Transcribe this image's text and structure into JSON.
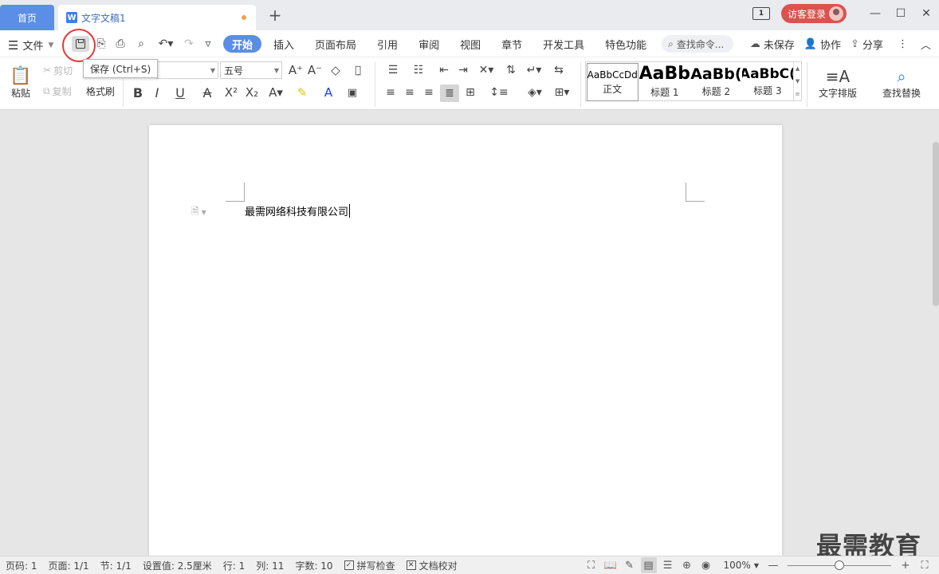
{
  "titlebar": {
    "home_tab": "首页",
    "doc_tab": "文字文稿1",
    "doc_icon": "W",
    "new_tab": "+",
    "screen_label": "1",
    "login": "访客登录",
    "minimize": "—",
    "maximize": "☐",
    "close": "✕"
  },
  "menubar": {
    "file": "文件",
    "tabs": [
      "开始",
      "插入",
      "页面布局",
      "引用",
      "审阅",
      "视图",
      "章节",
      "开发工具",
      "特色功能"
    ],
    "search_placeholder": "查找命令...",
    "unsaved": "未保存",
    "collab": "协作",
    "share": "分享"
  },
  "tooltip": "保存 (Ctrl+S)",
  "ribbon": {
    "paste": "粘贴",
    "cut": "剪切",
    "copy": "复制",
    "format_painter": "格式刷",
    "font_name": "",
    "font_size": "五号",
    "styles": [
      {
        "preview": "AaBbCcDd",
        "name": "正文"
      },
      {
        "preview": "AaBb",
        "name": "标题 1"
      },
      {
        "preview": "AaBb(",
        "name": "标题 2"
      },
      {
        "preview": "AaBbC(",
        "name": "标题 3"
      }
    ],
    "text_layout": "文字排版",
    "find_replace": "查找替换"
  },
  "document": {
    "text": "最需网络科技有限公司"
  },
  "watermark": "最需教育",
  "statusbar": {
    "page_num": "页码: 1",
    "pages": "页面: 1/1",
    "section": "节: 1/1",
    "setting": "设置值: 2.5厘米",
    "row": "行: 1",
    "col": "列: 11",
    "words": "字数: 10",
    "spell": "拼写检查",
    "proof": "文档校对",
    "zoom": "100%",
    "zoom_level": 0.5
  },
  "colors": {
    "accent": "#5a8ee6",
    "login": "#d9534f",
    "highlight_circle": "#e23a3a"
  }
}
